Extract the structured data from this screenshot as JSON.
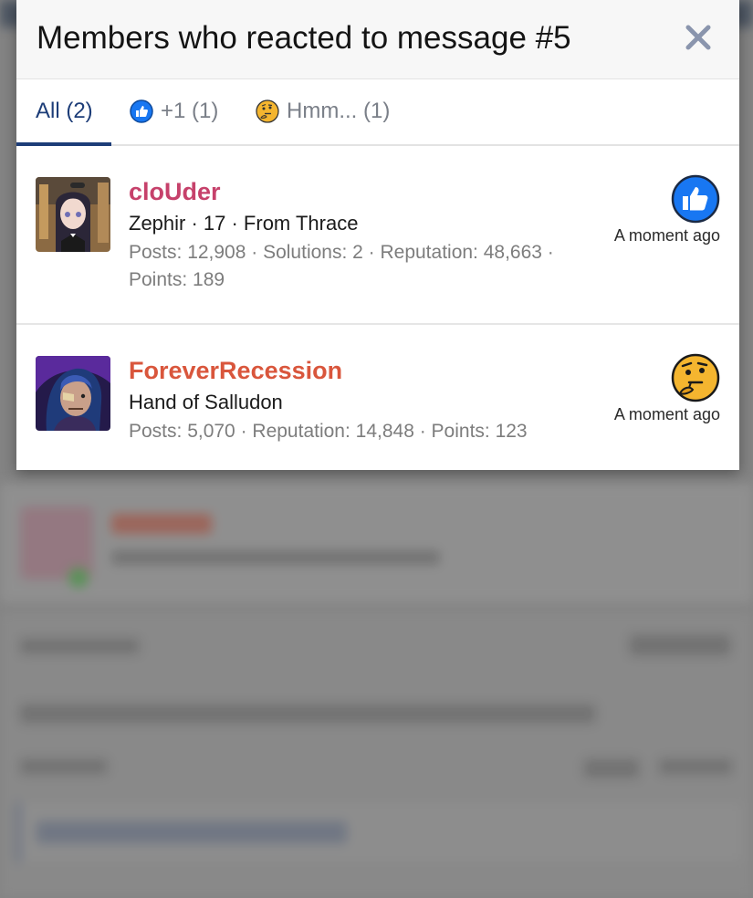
{
  "modal": {
    "title": "Members who reacted to message #5",
    "close_icon": "close-icon"
  },
  "tabs": [
    {
      "label": "All (2)",
      "icon": null,
      "active": true
    },
    {
      "label": "+1 (1)",
      "icon": "thumbs-up-icon",
      "active": false
    },
    {
      "label": "Hmm... (1)",
      "icon": "thinking-face-icon",
      "active": false
    }
  ],
  "members": [
    {
      "name": "cloUder",
      "name_color": "#c6416b",
      "title": "Zephir · 17 · From Thrace",
      "stats": "Posts: 12,908 · Solutions: 2 · Reputation: 48,663 · Points: 189",
      "reaction_icon": "thumbs-up-icon",
      "time": "A moment ago"
    },
    {
      "name": "ForeverRecession",
      "name_color": "#d9563c",
      "title": "Hand of Salludon",
      "stats": "Posts: 5,070 · Reputation: 14,848 · Points: 123",
      "reaction_icon": "thinking-face-icon",
      "time": "A moment ago"
    }
  ],
  "colors": {
    "accent": "#1d3d78",
    "like_blue": "#1877f2",
    "hmm_yellow": "#f4b52f"
  }
}
